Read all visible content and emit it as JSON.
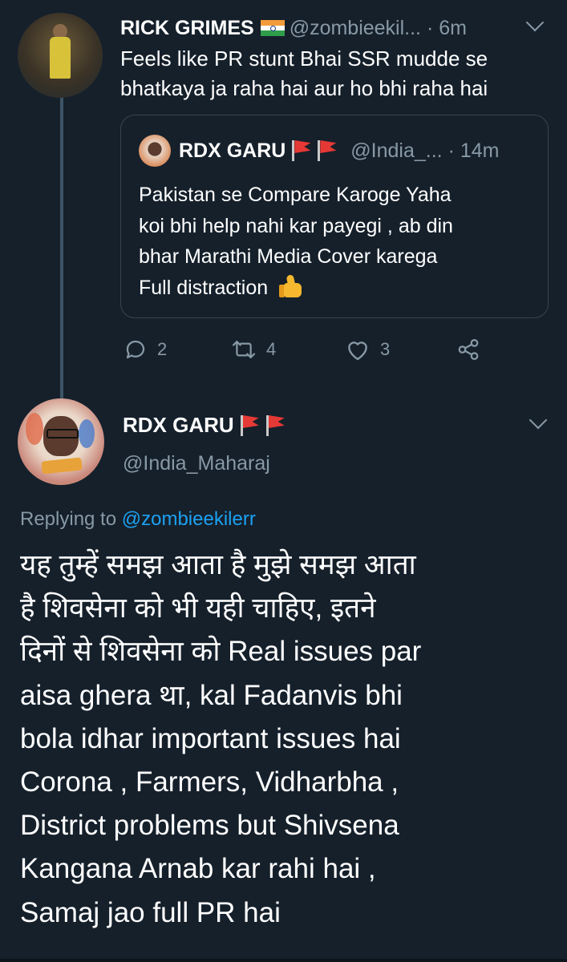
{
  "parent_tweet": {
    "display_name": "RICK GRIMES",
    "flag": "india-flag",
    "handle": "@zombieekil...",
    "time": "· 6m",
    "text_lines": [
      "Feels like PR stunt Bhai SSR mudde se",
      "bhatkaya ja raha hai aur ho bhi raha hai"
    ],
    "quoted": {
      "display_name": "RDX GARU",
      "flags": [
        "red-flag-icon",
        "red-flag-icon"
      ],
      "handle": "@India_...",
      "time": "· 14m",
      "text_lines": [
        "Pakistan se Compare Karoge Yaha",
        "koi bhi help nahi kar payegi , ab din",
        "bhar Marathi Media Cover karega",
        "Full distraction"
      ],
      "emoji": "thumbs-up-icon"
    },
    "actions": {
      "reply_count": "2",
      "retweet_count": "4",
      "like_count": "3"
    }
  },
  "main_tweet": {
    "display_name": "RDX GARU",
    "handle": "@India_Maharaj",
    "replying_prefix": "Replying to",
    "replying_to": "@zombieekilerr",
    "body_lines": [
      "यह तुम्हें समझ आता है मुझे समझ आता",
      "है शिवसेना को भी यही चाहिए, इतने",
      "दिनों से शिवसेना को Real issues par",
      "aisa ghera था, kal Fadanvis bhi",
      "bola idhar  important issues hai",
      "Corona , Farmers, Vidharbha ,",
      "District problems but Shivsena",
      "Kangana Arnab kar rahi hai ,",
      "Samaj jao full PR hai"
    ]
  },
  "colors": {
    "background": "#15202b",
    "text": "#ffffff",
    "muted": "#8899a6",
    "link": "#1da1f2",
    "border": "#38444d"
  }
}
